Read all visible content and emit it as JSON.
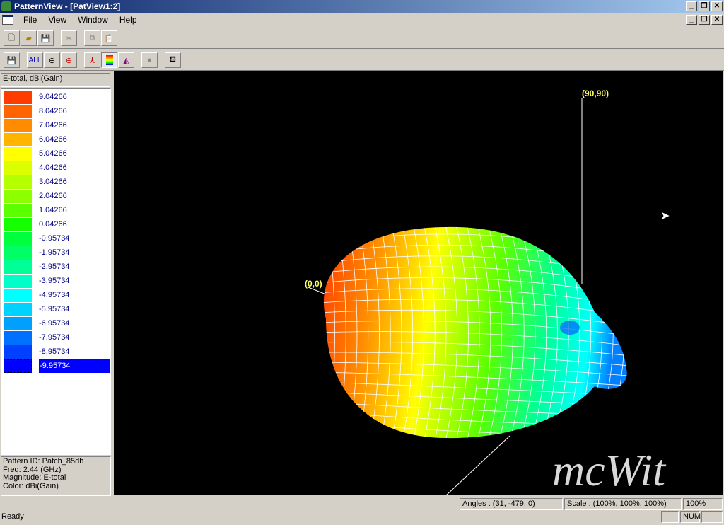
{
  "window": {
    "title": "PatternView - [PatView1:2]"
  },
  "menu": [
    "File",
    "View",
    "Window",
    "Help"
  ],
  "toolbar1": [
    "new-icon",
    "open-icon",
    "save-icon",
    "cut-icon",
    "copy-icon",
    "paste-icon"
  ],
  "toolbar2": {
    "all_label": "ALL"
  },
  "legend": {
    "title": "E-total, dBi(Gain)",
    "items": [
      {
        "value": "9.04266",
        "color": "#ff3c00"
      },
      {
        "value": "8.04266",
        "color": "#ff6400"
      },
      {
        "value": "7.04266",
        "color": "#ff8c00"
      },
      {
        "value": "6.04266",
        "color": "#ffb400"
      },
      {
        "value": "5.04266",
        "color": "#ffff00"
      },
      {
        "value": "4.04266",
        "color": "#dcff00"
      },
      {
        "value": "3.04266",
        "color": "#b4ff00"
      },
      {
        "value": "2.04266",
        "color": "#8cff00"
      },
      {
        "value": "1.04266",
        "color": "#5aff00"
      },
      {
        "value": "0.04266",
        "color": "#14ff00"
      },
      {
        "value": "-0.95734",
        "color": "#00ff3c"
      },
      {
        "value": "-1.95734",
        "color": "#00ff64"
      },
      {
        "value": "-2.95734",
        "color": "#00ff96"
      },
      {
        "value": "-3.95734",
        "color": "#00ffc8"
      },
      {
        "value": "-4.95734",
        "color": "#00ffff"
      },
      {
        "value": "-5.95734",
        "color": "#00d2ff"
      },
      {
        "value": "-6.95734",
        "color": "#00a0ff"
      },
      {
        "value": "-7.95734",
        "color": "#0070ff"
      },
      {
        "value": "-8.95734",
        "color": "#0040ff"
      },
      {
        "value": "-9.95734",
        "color": "#0000ff"
      }
    ]
  },
  "info": {
    "pattern_id": "Pattern ID: Patch_85db",
    "freq": "Freq: 2.44 (GHz)",
    "magnitude": "Magnitude: E-total",
    "color": "Color: dBi(Gain)"
  },
  "view": {
    "label_origin": "(0,0)",
    "label_axis": "(90,90)",
    "watermark": "mcWit"
  },
  "status": {
    "ready": "Ready",
    "angles": "Angles : (31, -479, 0)",
    "scale": "Scale : (100%, 100%, 100%)",
    "zoom": "100%",
    "num": "NUM"
  }
}
